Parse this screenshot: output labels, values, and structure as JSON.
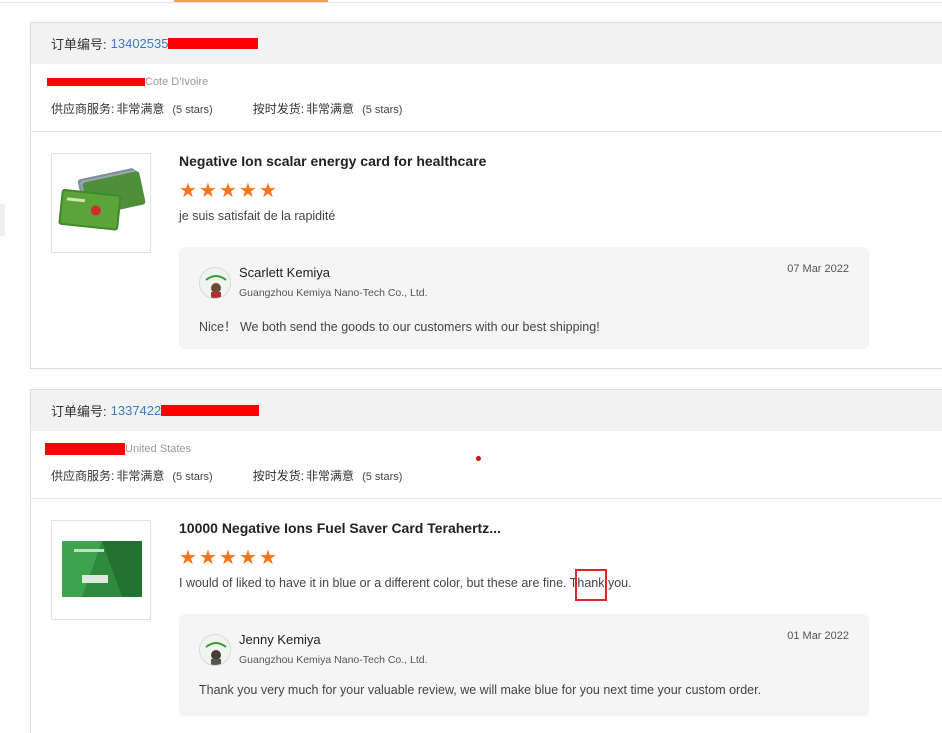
{
  "labels": {
    "order_no": "订单编号:",
    "supplier_service": "供应商服务:",
    "on_time_shipping": "按时发货:"
  },
  "orders": [
    {
      "order_number": "13402535",
      "buyer_country": "Cote D'Ivoire",
      "supplier_service_value": "非常满意",
      "supplier_service_stars": "(5 stars)",
      "shipping_value": "非常满意",
      "shipping_stars": "(5 stars)",
      "product_title": "Negative Ion scalar energy card for healthcare",
      "rating": 5,
      "review": "je suis satisfait de la rapidité",
      "reply": {
        "name": "Scarlett Kemiya",
        "company": "Guangzhou Kemiya Nano-Tech Co., Ltd.",
        "date": "07 Mar 2022",
        "text": "Nice！ We both send the goods to our customers with our best shipping!"
      }
    },
    {
      "order_number": "1337422",
      "buyer_country": "United States",
      "supplier_service_value": "非常满意",
      "supplier_service_stars": "(5 stars)",
      "shipping_value": "非常满意",
      "shipping_stars": "(5 stars)",
      "product_title": "10000 Negative Ions Fuel Saver Card Terahertz...",
      "rating": 5,
      "review": "I would of liked to have it in blue or a different color, but these are fine. Thank you.",
      "reply": {
        "name": "Jenny Kemiya",
        "company": "Guangzhou Kemiya Nano-Tech Co., Ltd.",
        "date": "01 Mar 2022",
        "text": "Thank you very much for your valuable review, we will make blue for you next time your custom order."
      }
    }
  ],
  "icons": {
    "star": "star-icon",
    "redaction": "redaction-mark"
  },
  "colors": {
    "star": "#f5761a",
    "link": "#3a7bc8",
    "redaction": "#ff0000",
    "highlight": "#e0242a"
  }
}
